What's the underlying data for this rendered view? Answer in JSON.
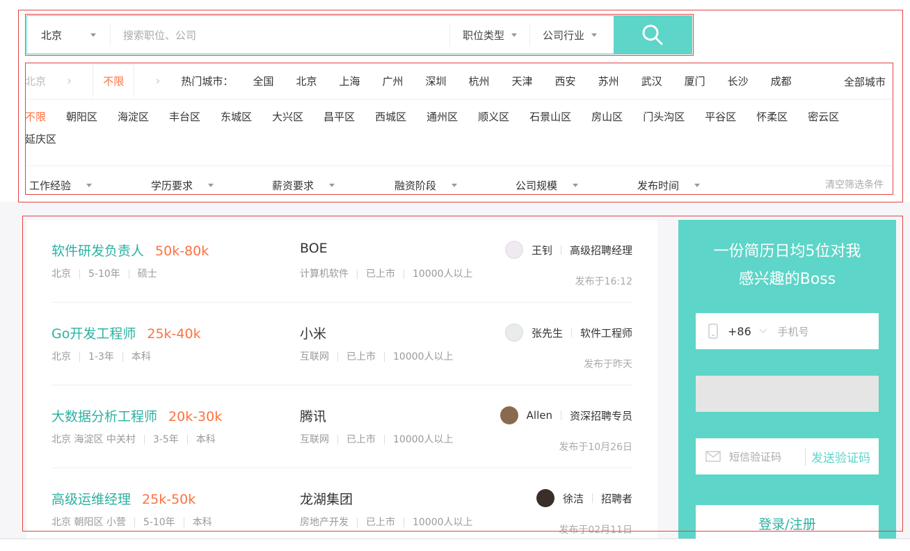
{
  "search": {
    "city": "北京",
    "placeholder": "搜索职位、公司",
    "job_type": "职位类型",
    "industry": "公司行业"
  },
  "city_row": {
    "current": "北京",
    "unlimited": "不限",
    "hot_label": "热门城市：",
    "cities": [
      "全国",
      "北京",
      "上海",
      "广州",
      "深圳",
      "杭州",
      "天津",
      "西安",
      "苏州",
      "武汉",
      "厦门",
      "长沙",
      "成都"
    ],
    "all_cities": "全部城市"
  },
  "districts": [
    "不限",
    "朝阳区",
    "海淀区",
    "丰台区",
    "东城区",
    "大兴区",
    "昌平区",
    "西城区",
    "通州区",
    "顺义区",
    "石景山区",
    "房山区",
    "门头沟区",
    "平谷区",
    "怀柔区",
    "密云区",
    "延庆区"
  ],
  "conditions": {
    "items": [
      "工作经验",
      "学历要求",
      "薪资要求",
      "融资阶段",
      "公司规模",
      "发布时间"
    ],
    "clear": "清空筛选条件"
  },
  "jobs": [
    {
      "title": "软件研发负责人",
      "salary": "50k-80k",
      "location": "北京",
      "experience": "5-10年",
      "degree": "硕士",
      "company": "BOE",
      "industry": "计算机软件",
      "stage": "已上市",
      "size": "10000人以上",
      "recruiter": "王钊",
      "role": "高级招聘经理",
      "time": "发布于16:12"
    },
    {
      "title": "Go开发工程师",
      "salary": "25k-40k",
      "location": "北京",
      "experience": "1-3年",
      "degree": "本科",
      "company": "小米",
      "industry": "互联网",
      "stage": "已上市",
      "size": "10000人以上",
      "recruiter": "张先生",
      "role": "软件工程师",
      "time": "发布于昨天"
    },
    {
      "title": "大数据分析工程师",
      "salary": "20k-30k",
      "location": "北京 海淀区 中关村",
      "experience": "3-5年",
      "degree": "本科",
      "company": "腾讯",
      "industry": "互联网",
      "stage": "已上市",
      "size": "10000人以上",
      "recruiter": "Allen",
      "role": "资深招聘专员",
      "time": "发布于10月26日"
    },
    {
      "title": "高级运维经理",
      "salary": "25k-50k",
      "location": "北京 朝阳区 小营",
      "experience": "5-10年",
      "degree": "本科",
      "company": "龙湖集团",
      "industry": "房地产开发",
      "stage": "已上市",
      "size": "10000人以上",
      "recruiter": "徐洁",
      "role": "招聘者",
      "time": "发布于02月11日"
    }
  ],
  "login": {
    "slogan_line1": "一份简历日均5位对我",
    "slogan_line2": "感兴趣的Boss",
    "country_code": "+86",
    "phone_placeholder": "手机号",
    "sms_placeholder": "短信验证码",
    "send_code": "发送验证码",
    "submit": "登录/注册"
  },
  "colors": {
    "accent": "#5dd5c8",
    "salary": "#fd7240",
    "title": "#2cb1a1"
  }
}
